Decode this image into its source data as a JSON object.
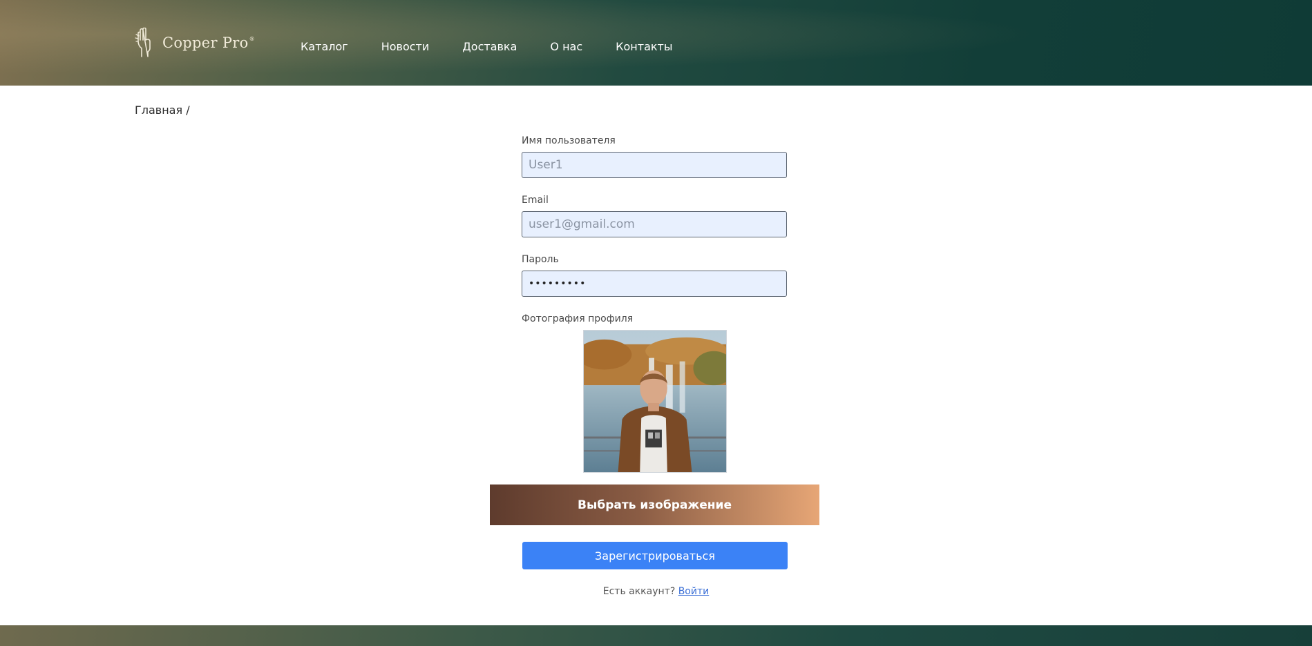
{
  "header": {
    "logo_text": "Copper Pro",
    "logo_mark": "®",
    "nav": [
      "Каталог",
      "Новости",
      "Доставка",
      "О нас",
      "Контакты"
    ]
  },
  "breadcrumb": "Главная /",
  "form": {
    "username": {
      "label": "Имя пользователя",
      "placeholder": "User1",
      "value": ""
    },
    "email": {
      "label": "Email",
      "placeholder": "user1@gmail.com",
      "value": ""
    },
    "password": {
      "label": "Пароль",
      "value": "•••••••••"
    },
    "photo": {
      "label": "Фотография профиля"
    },
    "choose_button": "Выбрать изображение",
    "register_button": "Зарегистрироваться",
    "login_prompt": "Есть аккаунт?",
    "login_link": "Войти"
  },
  "colors": {
    "header_dark": "#0f3b36",
    "header_light": "#7e7050",
    "input_bg": "#e8f0fe",
    "primary_blue": "#3b82f6",
    "copper_dark": "#5e3b2d",
    "copper_light": "#e7a676"
  }
}
